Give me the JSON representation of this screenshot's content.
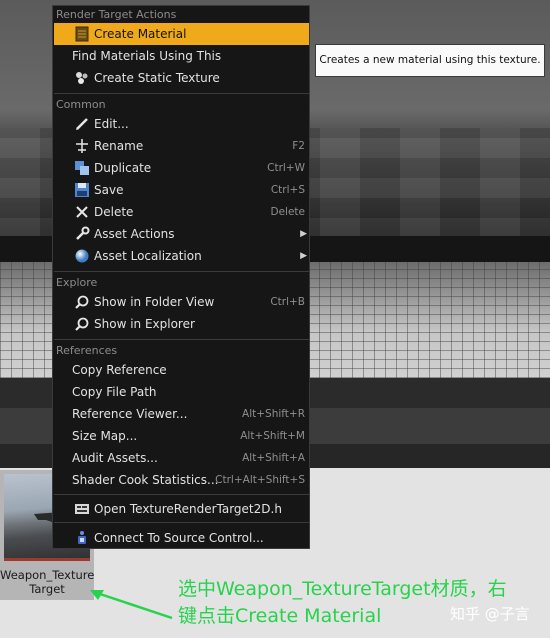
{
  "menu": {
    "sections": {
      "render_target_actions": "Render Target Actions",
      "common": "Common",
      "explore": "Explore",
      "references": "References"
    },
    "items": {
      "create_material": "Create Material",
      "find_materials": "Find Materials Using This",
      "create_static_texture": "Create Static Texture",
      "edit": "Edit...",
      "rename": "Rename",
      "rename_shortcut": "F2",
      "duplicate": "Duplicate",
      "duplicate_shortcut": "Ctrl+W",
      "save": "Save",
      "save_shortcut": "Ctrl+S",
      "delete": "Delete",
      "delete_shortcut": "Delete",
      "asset_actions": "Asset Actions",
      "asset_localization": "Asset Localization",
      "show_in_folder_view": "Show in Folder View",
      "show_in_folder_view_shortcut": "Ctrl+B",
      "show_in_explorer": "Show in Explorer",
      "copy_reference": "Copy Reference",
      "copy_file_path": "Copy File Path",
      "reference_viewer": "Reference Viewer...",
      "reference_viewer_shortcut": "Alt+Shift+R",
      "size_map": "Size Map...",
      "size_map_shortcut": "Alt+Shift+M",
      "audit_assets": "Audit Assets...",
      "audit_assets_shortcut": "Alt+Shift+A",
      "shader_cook_statistics": "Shader Cook Statistics...",
      "shader_cook_statistics_shortcut": "Ctrl+Alt+Shift+S",
      "open_texture": "Open TextureRenderTarget2D.h",
      "connect_source_control": "Connect To Source Control..."
    }
  },
  "tooltip": "Creates a new material using this texture.",
  "asset": {
    "name_line1": "Weapon_Texture",
    "name_line2": "Target"
  },
  "annotation": {
    "line1": "选中Weapon_TextureTarget材质，右",
    "line2": "键点击Create Material"
  },
  "watermark": "知乎 @子言",
  "colors": {
    "highlight": "#f0a91b",
    "annotation": "#27d34c"
  }
}
